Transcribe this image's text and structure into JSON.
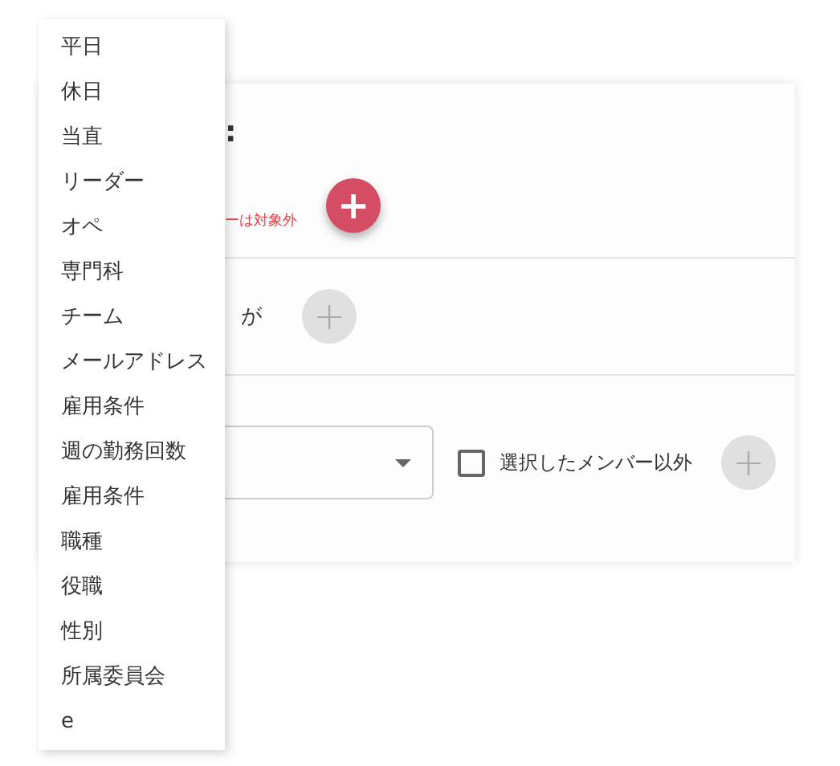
{
  "panel": {
    "title": ":",
    "note": "ーは対象外",
    "add_button": {
      "label": "+",
      "disabled": false
    },
    "condition": {
      "label": "が",
      "add_button": {
        "label": "+",
        "disabled": true
      }
    },
    "filter": {
      "checkbox": {
        "label": "選択したメンバー以外",
        "checked": false
      },
      "add_button": {
        "label": "+",
        "disabled": true
      }
    }
  },
  "menu": {
    "items": [
      {
        "label": "平日"
      },
      {
        "label": "休日"
      },
      {
        "label": "当直"
      },
      {
        "label": "リーダー"
      },
      {
        "label": "オペ"
      },
      {
        "label": "専門科"
      },
      {
        "label": "チーム"
      },
      {
        "label": "メールアドレス"
      },
      {
        "label": "雇用条件"
      },
      {
        "label": "週の勤務回数"
      },
      {
        "label": "雇用条件"
      },
      {
        "label": "職種"
      },
      {
        "label": "役職"
      },
      {
        "label": "性別"
      },
      {
        "label": "所属委員会"
      },
      {
        "label": "e"
      }
    ]
  }
}
